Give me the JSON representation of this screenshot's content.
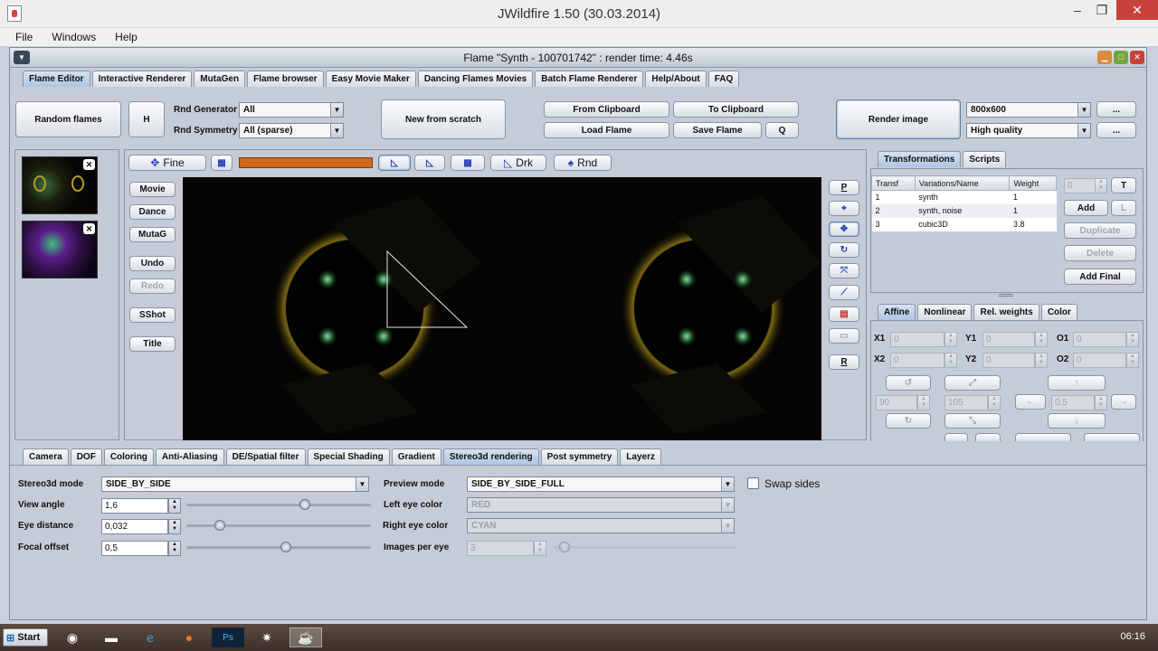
{
  "os": {
    "title": "JWildfire 1.50 (30.03.2014)",
    "minimize": "‒",
    "restore": "❐",
    "close": "✕"
  },
  "menu": [
    "File",
    "Windows",
    "Help"
  ],
  "frame": {
    "title": "Flame \"Synth - 100701742\" : render time: 4.46s"
  },
  "main_tabs": [
    "Flame Editor",
    "Interactive Renderer",
    "MutaGen",
    "Flame browser",
    "Easy Movie Maker",
    "Dancing Flames Movies",
    "Batch Flame Renderer",
    "Help/About",
    "FAQ"
  ],
  "toolbar": {
    "random_flames": "Random flames",
    "h": "H",
    "rnd_generator_label": "Rnd Generator",
    "rnd_generator_value": "All",
    "rnd_symmetry_label": "Rnd Symmetry",
    "rnd_symmetry_value": "All (sparse)",
    "new_from_scratch": "New from scratch",
    "from_clipboard": "From Clipboard",
    "to_clipboard": "To Clipboard",
    "load_flame": "Load Flame",
    "save_flame": "Save Flame",
    "q": "Q",
    "render_image": "Render image",
    "resolution": "800x600",
    "quality": "High quality",
    "more1": "...",
    "more2": "..."
  },
  "canvas_toolbar": {
    "fine": "Fine",
    "drk": "Drk",
    "rnd": "Rnd"
  },
  "left_buttons": [
    "Movie",
    "Dance",
    "MutaG",
    "Undo",
    "Redo",
    "SShot",
    "Title"
  ],
  "right_tools": {
    "p": "P",
    "r": "R"
  },
  "right_tabs": [
    "Transformations",
    "Scripts"
  ],
  "transforms": {
    "headers": [
      "Transf",
      "Variations/Name",
      "Weight"
    ],
    "rows": [
      [
        "1",
        "synth",
        "1"
      ],
      [
        "2",
        "synth, noise",
        "1"
      ],
      [
        "3",
        "cubic3D",
        "3.8"
      ]
    ],
    "spinner_value": "0",
    "t": "T",
    "l": "L",
    "add": "Add",
    "duplicate": "Duplicate",
    "delete": "Delete",
    "add_final": "Add Final"
  },
  "affine_tabs": [
    "Affine",
    "Nonlinear",
    "Rel. weights",
    "Color"
  ],
  "affine": {
    "x1": "X1",
    "y1": "Y1",
    "o1": "O1",
    "x2": "X2",
    "y2": "Y2",
    "o2": "O2",
    "zero": "0",
    "rotate": "90",
    "scale": "105",
    "move": "0.5"
  },
  "bottom_tabs": [
    "Camera",
    "DOF",
    "Coloring",
    "Anti-Aliasing",
    "DE/Spatial filter",
    "Special Shading",
    "Gradient",
    "Stereo3d rendering",
    "Post symmetry",
    "Layerz"
  ],
  "stereo": {
    "mode_label": "Stereo3d mode",
    "mode_value": "SIDE_BY_SIDE",
    "view_angle_label": "View angle",
    "view_angle_value": "1,6",
    "view_angle_level": 0.64,
    "eye_distance_label": "Eye distance",
    "eye_distance_value": "0,032",
    "eye_distance_level": 0.18,
    "focal_offset_label": "Focal offset",
    "focal_offset_value": "0,5",
    "focal_offset_level": 0.54,
    "preview_mode_label": "Preview mode",
    "preview_mode_value": "SIDE_BY_SIDE_FULL",
    "left_eye_label": "Left eye color",
    "left_eye_value": "RED",
    "right_eye_label": "Right eye color",
    "right_eye_value": "CYAN",
    "images_per_eye_label": "Images per eye",
    "images_per_eye_value": "3",
    "swap_sides": "Swap sides"
  },
  "taskbar": {
    "start": "Start",
    "clock": "06:16"
  }
}
